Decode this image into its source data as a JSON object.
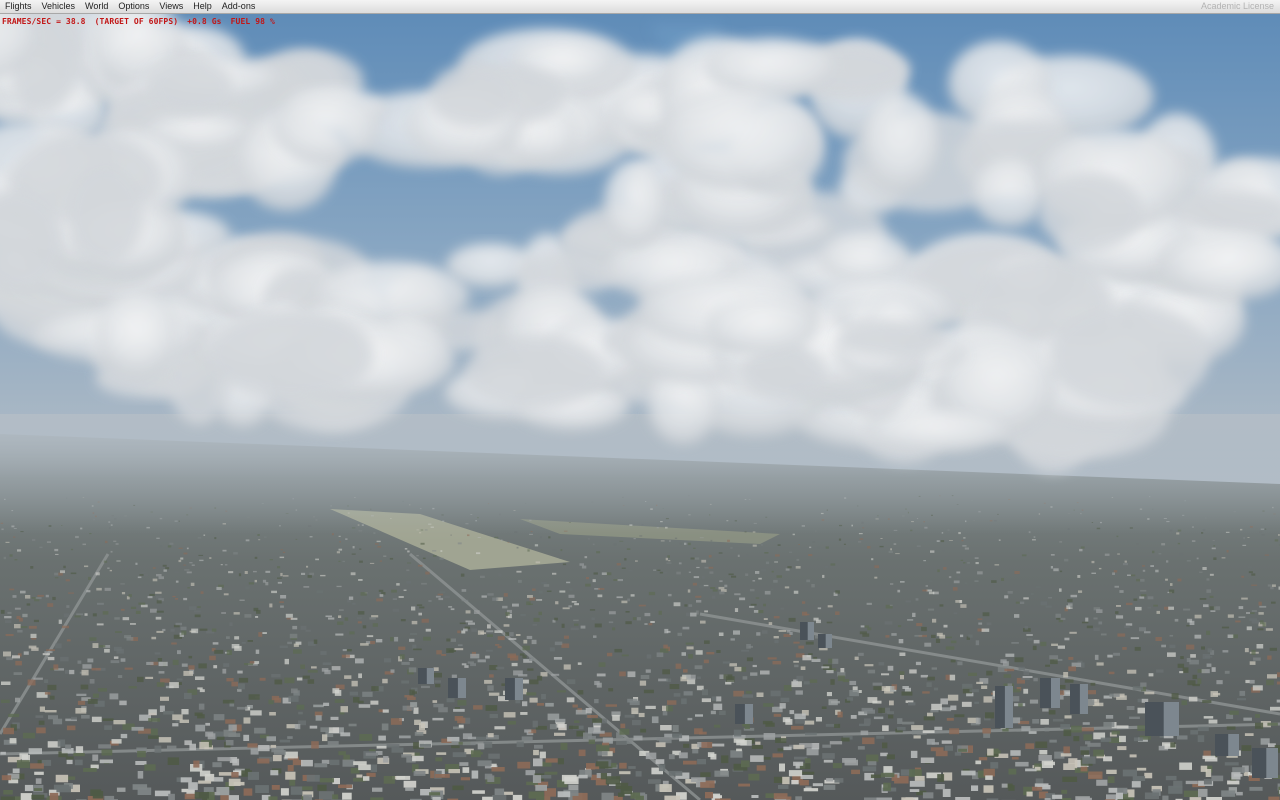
{
  "menu": {
    "items": [
      {
        "label": "Flights"
      },
      {
        "label": "Vehicles"
      },
      {
        "label": "World"
      },
      {
        "label": "Options"
      },
      {
        "label": "Views"
      },
      {
        "label": "Help"
      },
      {
        "label": "Add-ons"
      }
    ],
    "license_label": "Academic License"
  },
  "hud": {
    "fps": "FRAMES/SEC = 38.8",
    "target": "(TARGET OF 60FPS)",
    "gforce": "+0.8 Gs",
    "fuel": "FUEL 98 %"
  },
  "colors": {
    "hud_text": "#c21616",
    "sky_blue": "#6f98bf",
    "cloud": "#e9ecef",
    "haze": "#aab5bf",
    "city": "#5d6468"
  }
}
